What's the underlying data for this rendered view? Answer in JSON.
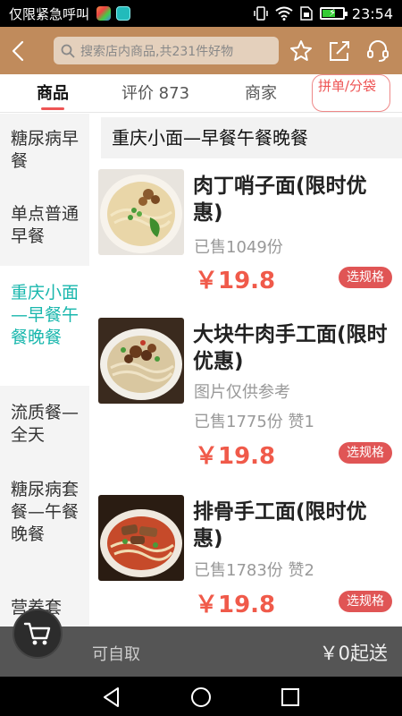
{
  "status": {
    "carrier": "仅限紧急呼叫",
    "time": "23:54"
  },
  "header": {
    "search_placeholder": "搜索店内商品,共231件好物"
  },
  "tabs": [
    {
      "label": "商品",
      "active": true
    },
    {
      "label": "评价 873",
      "active": false
    },
    {
      "label": "商家",
      "active": false
    },
    {
      "label": "拼单/分袋",
      "active": false
    }
  ],
  "sidebar": {
    "items": [
      {
        "label": "糖尿病早餐",
        "active": false
      },
      {
        "label": "单点普通早餐",
        "active": false
      },
      {
        "label": "重庆小面—早餐午餐晚餐",
        "active": true
      },
      {
        "label": "流质餐—全天",
        "active": false
      },
      {
        "label": "糖尿病套餐—午餐晚餐",
        "active": false
      },
      {
        "label": "营养套",
        "active": false
      }
    ]
  },
  "section": {
    "title": "重庆小面—早餐午餐晚餐"
  },
  "products": [
    {
      "name": "肉丁哨子面(限时优惠)",
      "note": "",
      "sold": "已售1049份",
      "price": "￥19.8",
      "spec_button": "选规格"
    },
    {
      "name": "大块牛肉手工面(限时优惠)",
      "note": "图片仅供参考",
      "sold": "已售1775份 赞1",
      "price": "￥19.8",
      "spec_button": "选规格"
    },
    {
      "name": "排骨手工面(限时优惠)",
      "note": "",
      "sold": "已售1783份 赞2",
      "price": "￥19.8",
      "spec_button": "选规格"
    }
  ],
  "bottom": {
    "pickup_label": "可自取",
    "min_order": "￥0起送"
  },
  "colors": {
    "header_bg": "#c08b5c",
    "accent_teal": "#19b7ad",
    "price_red": "#f05a4a",
    "spec_button_bg": "#e05555",
    "bottom_bar_bg": "#555555"
  },
  "icons": [
    "back-arrow-icon",
    "search-icon",
    "star-icon",
    "share-icon",
    "customer-service-icon",
    "cart-icon",
    "nav-back-icon",
    "nav-home-icon",
    "nav-recents-icon"
  ]
}
